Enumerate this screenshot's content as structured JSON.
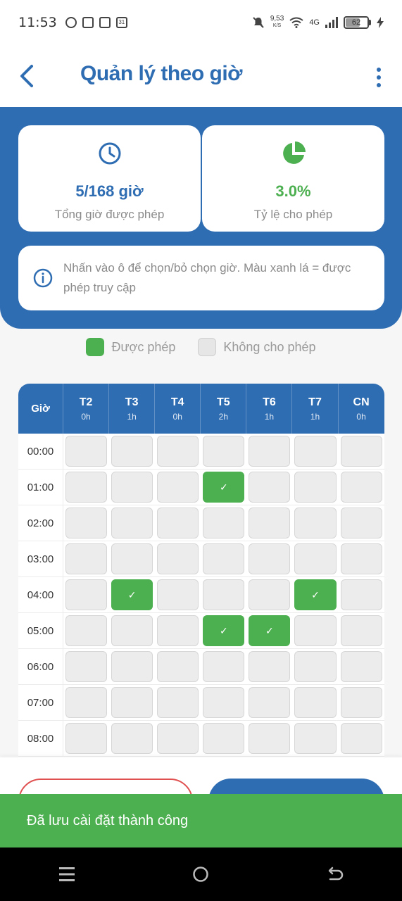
{
  "status_bar": {
    "time": "11:53",
    "net_speed": "9,53",
    "net_unit": "K/S",
    "network_type": "4G",
    "battery": "62",
    "battery_fraction": 0.62,
    "calendar_badge": "31"
  },
  "app_bar": {
    "title": "Quản lý theo giờ"
  },
  "stats": {
    "allowed_hours": {
      "value": "5/168 giờ",
      "label": "Tổng giờ được phép",
      "icon": "clock-icon"
    },
    "allowed_ratio": {
      "value": "3.0%",
      "label": "Tỷ lệ cho phép",
      "icon": "pie-chart-icon"
    }
  },
  "info": {
    "text": "Nhấn vào ô để chọn/bỏ chọn giờ. Màu xanh lá = được phép truy cập",
    "icon": "info-icon"
  },
  "legend": {
    "allowed": "Được phép",
    "not_allowed": "Không cho phép"
  },
  "grid": {
    "hour_header": "Giờ",
    "days": [
      {
        "label": "T2",
        "hours": "0h"
      },
      {
        "label": "T3",
        "hours": "1h"
      },
      {
        "label": "T4",
        "hours": "0h"
      },
      {
        "label": "T5",
        "hours": "2h"
      },
      {
        "label": "T6",
        "hours": "1h"
      },
      {
        "label": "T7",
        "hours": "1h"
      },
      {
        "label": "CN",
        "hours": "0h"
      }
    ],
    "rows": [
      {
        "hour": "00:00",
        "cells": [
          false,
          false,
          false,
          false,
          false,
          false,
          false
        ]
      },
      {
        "hour": "01:00",
        "cells": [
          false,
          false,
          false,
          true,
          false,
          false,
          false
        ]
      },
      {
        "hour": "02:00",
        "cells": [
          false,
          false,
          false,
          false,
          false,
          false,
          false
        ]
      },
      {
        "hour": "03:00",
        "cells": [
          false,
          false,
          false,
          false,
          false,
          false,
          false
        ]
      },
      {
        "hour": "04:00",
        "cells": [
          false,
          true,
          false,
          false,
          false,
          true,
          false
        ]
      },
      {
        "hour": "05:00",
        "cells": [
          false,
          false,
          false,
          true,
          true,
          false,
          false
        ]
      },
      {
        "hour": "06:00",
        "cells": [
          false,
          false,
          false,
          false,
          false,
          false,
          false
        ]
      },
      {
        "hour": "07:00",
        "cells": [
          false,
          false,
          false,
          false,
          false,
          false,
          false
        ]
      },
      {
        "hour": "08:00",
        "cells": [
          false,
          false,
          false,
          false,
          false,
          false,
          false
        ]
      }
    ],
    "check_mark": "✓"
  },
  "snackbar": {
    "message": "Đã lưu cài đặt thành công"
  },
  "colors": {
    "primary": "#2f6db3",
    "allowed": "#4caf50",
    "cancel_border": "#e05050"
  }
}
